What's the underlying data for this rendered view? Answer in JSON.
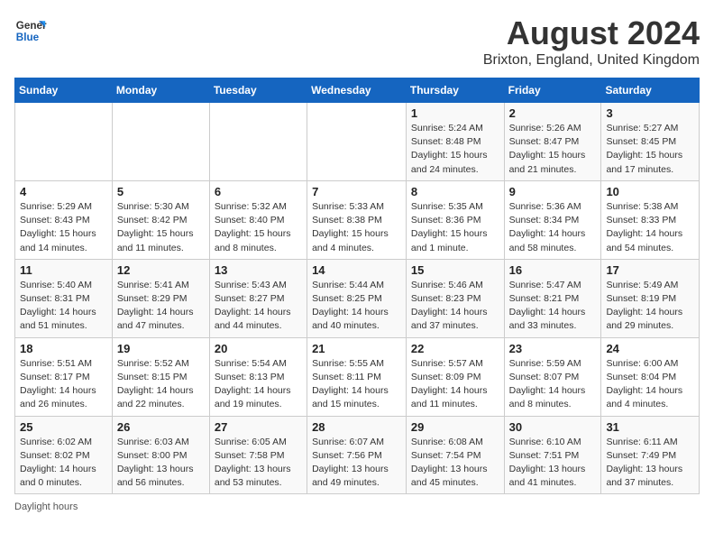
{
  "header": {
    "logo_line1": "General",
    "logo_line2": "Blue",
    "title": "August 2024",
    "subtitle": "Brixton, England, United Kingdom"
  },
  "weekdays": [
    "Sunday",
    "Monday",
    "Tuesday",
    "Wednesday",
    "Thursday",
    "Friday",
    "Saturday"
  ],
  "weeks": [
    [
      {
        "day": "",
        "info": ""
      },
      {
        "day": "",
        "info": ""
      },
      {
        "day": "",
        "info": ""
      },
      {
        "day": "",
        "info": ""
      },
      {
        "day": "1",
        "info": "Sunrise: 5:24 AM\nSunset: 8:48 PM\nDaylight: 15 hours\nand 24 minutes."
      },
      {
        "day": "2",
        "info": "Sunrise: 5:26 AM\nSunset: 8:47 PM\nDaylight: 15 hours\nand 21 minutes."
      },
      {
        "day": "3",
        "info": "Sunrise: 5:27 AM\nSunset: 8:45 PM\nDaylight: 15 hours\nand 17 minutes."
      }
    ],
    [
      {
        "day": "4",
        "info": "Sunrise: 5:29 AM\nSunset: 8:43 PM\nDaylight: 15 hours\nand 14 minutes."
      },
      {
        "day": "5",
        "info": "Sunrise: 5:30 AM\nSunset: 8:42 PM\nDaylight: 15 hours\nand 11 minutes."
      },
      {
        "day": "6",
        "info": "Sunrise: 5:32 AM\nSunset: 8:40 PM\nDaylight: 15 hours\nand 8 minutes."
      },
      {
        "day": "7",
        "info": "Sunrise: 5:33 AM\nSunset: 8:38 PM\nDaylight: 15 hours\nand 4 minutes."
      },
      {
        "day": "8",
        "info": "Sunrise: 5:35 AM\nSunset: 8:36 PM\nDaylight: 15 hours\nand 1 minute."
      },
      {
        "day": "9",
        "info": "Sunrise: 5:36 AM\nSunset: 8:34 PM\nDaylight: 14 hours\nand 58 minutes."
      },
      {
        "day": "10",
        "info": "Sunrise: 5:38 AM\nSunset: 8:33 PM\nDaylight: 14 hours\nand 54 minutes."
      }
    ],
    [
      {
        "day": "11",
        "info": "Sunrise: 5:40 AM\nSunset: 8:31 PM\nDaylight: 14 hours\nand 51 minutes."
      },
      {
        "day": "12",
        "info": "Sunrise: 5:41 AM\nSunset: 8:29 PM\nDaylight: 14 hours\nand 47 minutes."
      },
      {
        "day": "13",
        "info": "Sunrise: 5:43 AM\nSunset: 8:27 PM\nDaylight: 14 hours\nand 44 minutes."
      },
      {
        "day": "14",
        "info": "Sunrise: 5:44 AM\nSunset: 8:25 PM\nDaylight: 14 hours\nand 40 minutes."
      },
      {
        "day": "15",
        "info": "Sunrise: 5:46 AM\nSunset: 8:23 PM\nDaylight: 14 hours\nand 37 minutes."
      },
      {
        "day": "16",
        "info": "Sunrise: 5:47 AM\nSunset: 8:21 PM\nDaylight: 14 hours\nand 33 minutes."
      },
      {
        "day": "17",
        "info": "Sunrise: 5:49 AM\nSunset: 8:19 PM\nDaylight: 14 hours\nand 29 minutes."
      }
    ],
    [
      {
        "day": "18",
        "info": "Sunrise: 5:51 AM\nSunset: 8:17 PM\nDaylight: 14 hours\nand 26 minutes."
      },
      {
        "day": "19",
        "info": "Sunrise: 5:52 AM\nSunset: 8:15 PM\nDaylight: 14 hours\nand 22 minutes."
      },
      {
        "day": "20",
        "info": "Sunrise: 5:54 AM\nSunset: 8:13 PM\nDaylight: 14 hours\nand 19 minutes."
      },
      {
        "day": "21",
        "info": "Sunrise: 5:55 AM\nSunset: 8:11 PM\nDaylight: 14 hours\nand 15 minutes."
      },
      {
        "day": "22",
        "info": "Sunrise: 5:57 AM\nSunset: 8:09 PM\nDaylight: 14 hours\nand 11 minutes."
      },
      {
        "day": "23",
        "info": "Sunrise: 5:59 AM\nSunset: 8:07 PM\nDaylight: 14 hours\nand 8 minutes."
      },
      {
        "day": "24",
        "info": "Sunrise: 6:00 AM\nSunset: 8:04 PM\nDaylight: 14 hours\nand 4 minutes."
      }
    ],
    [
      {
        "day": "25",
        "info": "Sunrise: 6:02 AM\nSunset: 8:02 PM\nDaylight: 14 hours\nand 0 minutes."
      },
      {
        "day": "26",
        "info": "Sunrise: 6:03 AM\nSunset: 8:00 PM\nDaylight: 13 hours\nand 56 minutes."
      },
      {
        "day": "27",
        "info": "Sunrise: 6:05 AM\nSunset: 7:58 PM\nDaylight: 13 hours\nand 53 minutes."
      },
      {
        "day": "28",
        "info": "Sunrise: 6:07 AM\nSunset: 7:56 PM\nDaylight: 13 hours\nand 49 minutes."
      },
      {
        "day": "29",
        "info": "Sunrise: 6:08 AM\nSunset: 7:54 PM\nDaylight: 13 hours\nand 45 minutes."
      },
      {
        "day": "30",
        "info": "Sunrise: 6:10 AM\nSunset: 7:51 PM\nDaylight: 13 hours\nand 41 minutes."
      },
      {
        "day": "31",
        "info": "Sunrise: 6:11 AM\nSunset: 7:49 PM\nDaylight: 13 hours\nand 37 minutes."
      }
    ]
  ],
  "footer": {
    "note": "Daylight hours"
  }
}
